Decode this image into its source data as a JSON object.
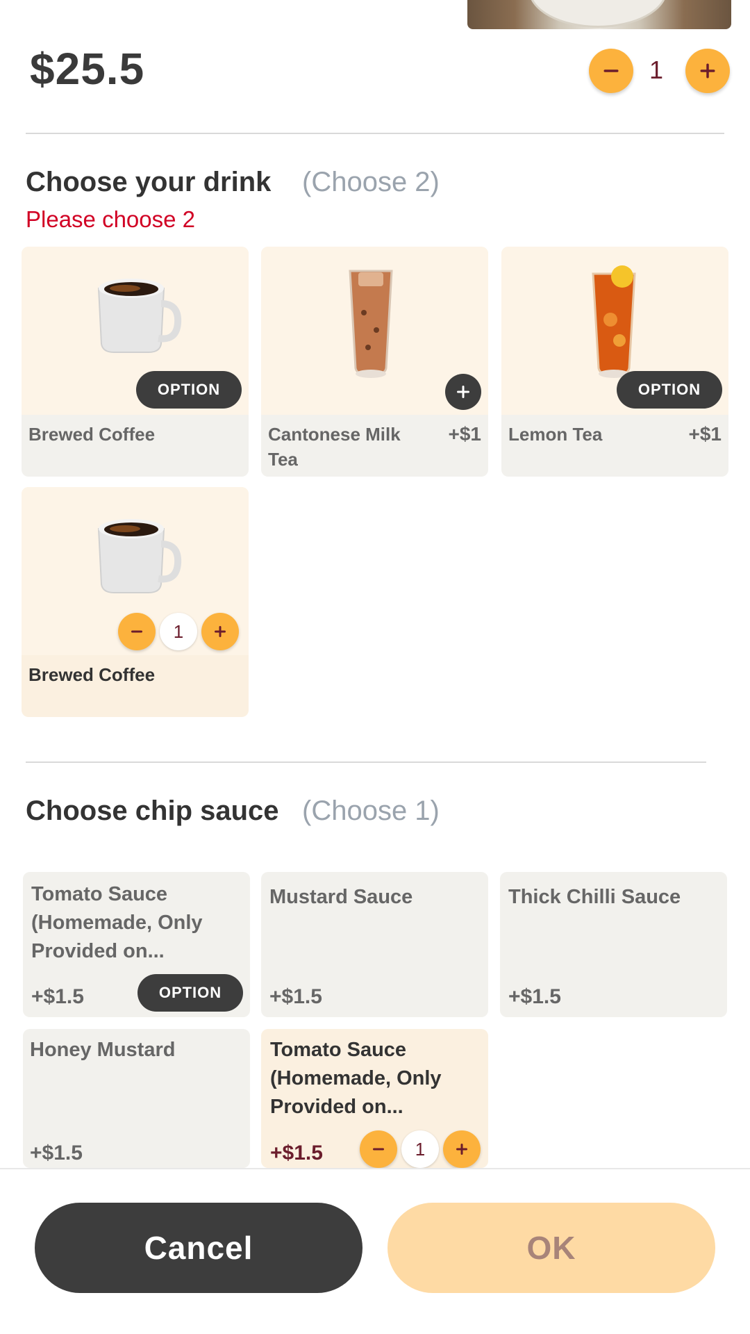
{
  "item": {
    "price": "$25.5",
    "quantity": "1"
  },
  "drink_section": {
    "title": "Choose your drink",
    "hint": "(Choose 2)",
    "error": "Please choose 2",
    "cards": [
      {
        "name": "Brewed Coffee",
        "extra": "",
        "action": "OPTION",
        "image": "coffee-mug-icon"
      },
      {
        "name": "Cantonese Milk Tea",
        "extra": "+$1",
        "action": "+",
        "image": "milk-tea-glass-icon"
      },
      {
        "name": "Lemon Tea",
        "extra": "+$1",
        "action": "OPTION",
        "image": "lemon-tea-glass-icon"
      },
      {
        "name": "Brewed Coffee",
        "extra": "",
        "quantity": "1",
        "selected": true,
        "image": "coffee-mug-icon"
      }
    ]
  },
  "sauce_section": {
    "title": "Choose chip sauce",
    "hint": "(Choose 1)",
    "cards": [
      {
        "name": "Tomato Sauce (Homemade, Only Provided on...",
        "price": "+$1.5",
        "action": "OPTION"
      },
      {
        "name": "Mustard Sauce",
        "price": "+$1.5"
      },
      {
        "name": "Thick Chilli Sauce",
        "price": "+$1.5"
      },
      {
        "name": "Honey Mustard",
        "price": "+$1.5"
      },
      {
        "name": "Tomato Sauce (Homemade, Only Provided on...",
        "price": "+$1.5",
        "quantity": "1",
        "selected": true
      }
    ]
  },
  "footer": {
    "cancel_label": "Cancel",
    "ok_label": "OK"
  },
  "colors": {
    "accent": "#fcb23d",
    "dark": "#3d3d3d",
    "error": "#d10024",
    "ok_disabled": "#fedaa4",
    "quantity_text": "#6b1d2c"
  }
}
